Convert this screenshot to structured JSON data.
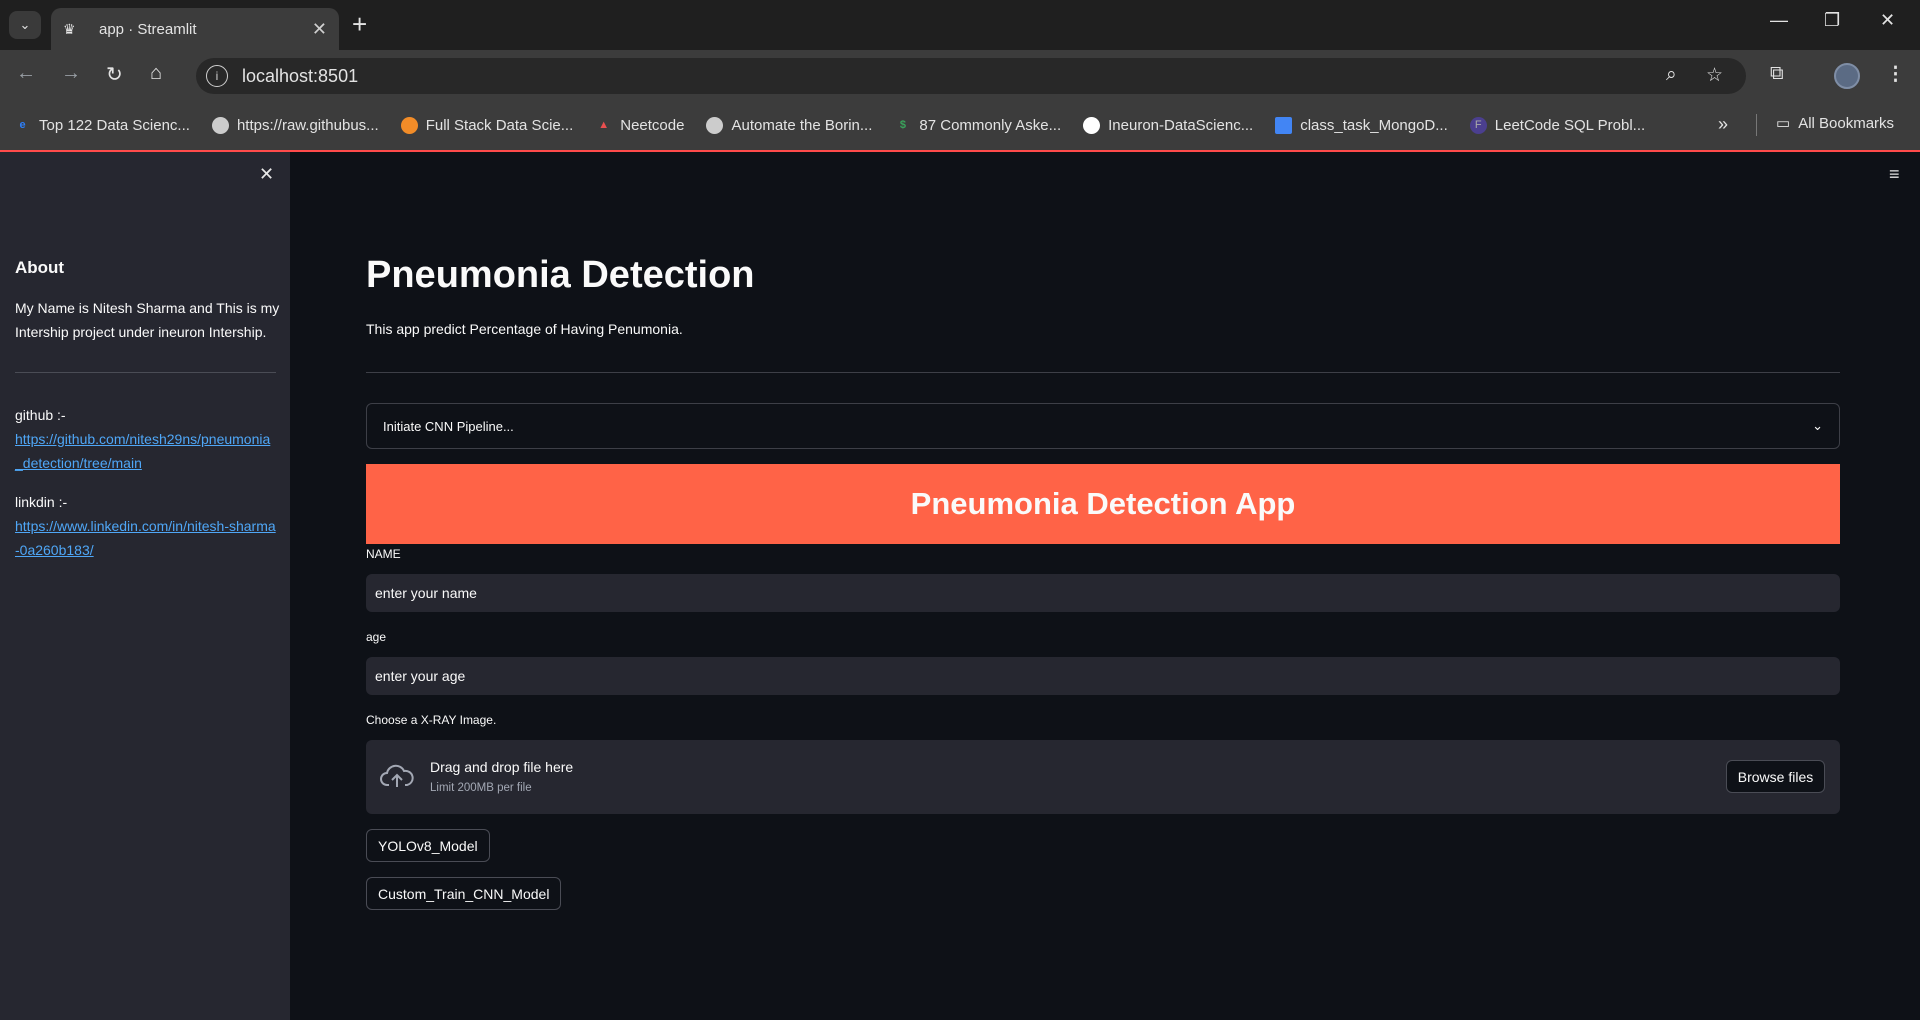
{
  "browser": {
    "tab_title": "app · Streamlit",
    "url": "localhost:8501",
    "bookmarks": [
      {
        "label": "Top 122 Data Scienc...",
        "icon": "el-icon",
        "color": "#2d7ff9"
      },
      {
        "label": "https://raw.githubus...",
        "icon": "globe-icon",
        "color": "#cccccc"
      },
      {
        "label": "Full Stack Data Scie...",
        "icon": "orange-circle-icon",
        "color": "#f28c28"
      },
      {
        "label": "Neetcode",
        "icon": "rocket-icon",
        "color": "#e94f4f"
      },
      {
        "label": "Automate the Borin...",
        "icon": "globe-icon",
        "color": "#cccccc"
      },
      {
        "label": "87 Commonly Aske...",
        "icon": "dollar-icon",
        "color": "#3aa35b"
      },
      {
        "label": "Ineuron-DataScienc...",
        "icon": "github-icon",
        "color": "#ffffff"
      },
      {
        "label": "class_task_MongoD...",
        "icon": "doc-icon",
        "color": "#4285f4"
      },
      {
        "label": "LeetCode SQL Probl...",
        "icon": "f-icon",
        "color": "#4b3f8f"
      }
    ],
    "all_bookmarks": "All Bookmarks"
  },
  "sidebar": {
    "heading": "About",
    "about_text": "My Name is Nitesh Sharma and This is my Intership project under ineuron Intership.",
    "github_label": "github :-",
    "github_url": "https://github.com/nitesh29ns/pneumonia_detection/tree/main",
    "linkedin_label": "linkdin :-",
    "linkedin_url": "https://www.linkedin.com/in/nitesh-sharma-0a260b183/"
  },
  "main": {
    "title": "Pneumonia Detection",
    "subtitle": "This app predict Percentage of Having Penumonia.",
    "expander_label": "Initiate CNN Pipeline...",
    "banner": "Pneumonia Detection App",
    "name_label": "NAME",
    "name_value": "enter your name",
    "age_label": "age",
    "age_value": "enter your age",
    "upload_label": "Choose a X-RAY Image.",
    "upload_title": "Drag and drop file here",
    "upload_limit": "Limit 200MB per file",
    "browse_label": "Browse files",
    "btn_yolo": "YOLOv8_Model",
    "btn_cnn": "Custom_Train_CNN_Model"
  },
  "colors": {
    "accent": "#ff6347",
    "link": "#4fa7f7",
    "background": "#0e1117",
    "sidebar": "#262730"
  }
}
